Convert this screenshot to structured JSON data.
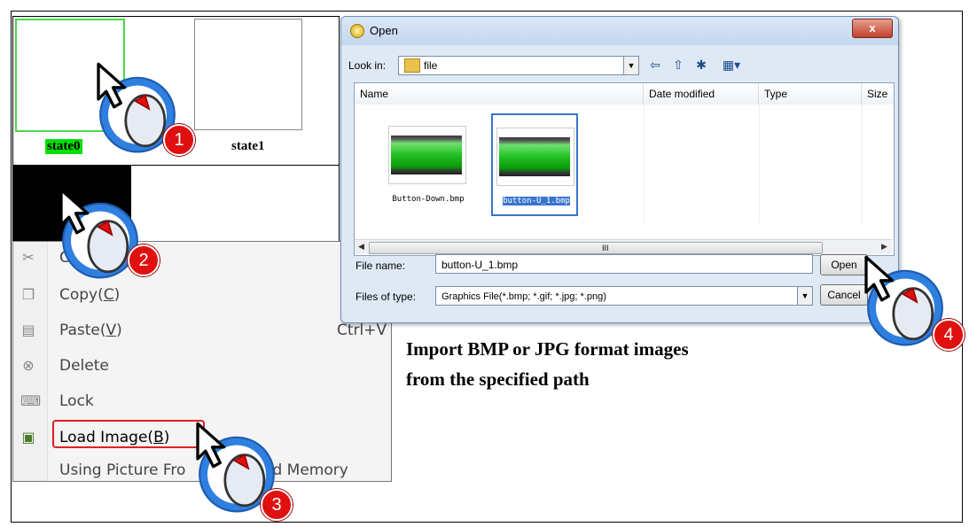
{
  "state_panel": {
    "state0_label": "state0",
    "state1_label": "state1"
  },
  "context_menu": {
    "items": [
      {
        "icon": "scissors-icon",
        "label": "C",
        "shortcut": ""
      },
      {
        "icon": "copy-icon",
        "label": "Copy(C)",
        "label_main": "Copy(",
        "label_key": "C",
        "label_end": ")",
        "shortcut": ""
      },
      {
        "icon": "paste-icon",
        "label_main": "Paste(",
        "label_key": "V",
        "label_end": ")",
        "shortcut": "Ctrl+V"
      },
      {
        "icon": "delete-icon",
        "label": "Delete"
      },
      {
        "icon": "lock-icon",
        "label": "Lock"
      },
      {
        "icon": "image-icon",
        "label_main": "Load Image(",
        "label_key": "B",
        "label_end": ")"
      },
      {
        "label_a": "Using Picture Fro",
        "label_b": "ed Memory"
      }
    ]
  },
  "dialog": {
    "title": "Open",
    "close_glyph": "x",
    "look_in_label": "Look in:",
    "look_in_value": "file",
    "columns": [
      "Name",
      "Date modified",
      "Type",
      "Size"
    ],
    "files": [
      {
        "name": "Button-Down.bmp",
        "selected": false
      },
      {
        "name": "button-U_1.bmp",
        "selected": true
      }
    ],
    "scroll_grip": "III",
    "file_name_label": "File name:",
    "file_name_value": "button-U_1.bmp",
    "files_of_type_label": "Files of type:",
    "files_of_type_value": "Graphics File(*.bmp; *.gif; *.jpg; *.png)",
    "open_button": "Open",
    "cancel_button": "Cancel"
  },
  "caption": {
    "line1": "Import BMP or JPG format images",
    "line2": "from the specified path"
  },
  "badges": [
    "1",
    "2",
    "3",
    "4"
  ],
  "colors": {
    "selection_green": "#00e000",
    "highlight_red": "#e02020",
    "badge_blue": "#2f7fe0",
    "badge_red": "#e01010"
  }
}
